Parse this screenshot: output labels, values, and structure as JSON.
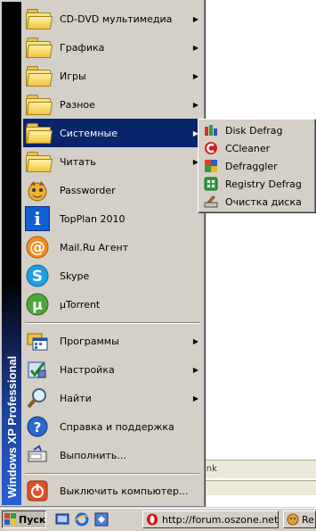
{
  "banner": {
    "text": "Windows XP  Professional"
  },
  "menu": {
    "items": [
      {
        "label": "CD-DVD мультимедиа",
        "icon": "folder-icon",
        "submenu": true
      },
      {
        "label": "Графика",
        "icon": "folder-icon",
        "submenu": true
      },
      {
        "label": "Игры",
        "icon": "folder-icon",
        "submenu": true
      },
      {
        "label": "Разное",
        "icon": "folder-icon",
        "submenu": true
      },
      {
        "label": "Системные",
        "icon": "folder-icon",
        "submenu": true,
        "selected": true
      },
      {
        "label": "Читать",
        "icon": "folder-icon",
        "submenu": true
      },
      {
        "label": "Passworder",
        "icon": "passworder-icon"
      },
      {
        "label": "TopPlan 2010",
        "icon": "topplan-icon"
      },
      {
        "label": "Mail.Ru Агент",
        "icon": "mailru-agent-icon"
      },
      {
        "label": "Skype",
        "icon": "skype-icon"
      },
      {
        "label": "µTorrent",
        "icon": "utorrent-icon"
      },
      {
        "label": "Программы",
        "icon": "programs-icon",
        "submenu": true
      },
      {
        "label": "Настройка",
        "icon": "settings-icon",
        "submenu": true
      },
      {
        "label": "Найти",
        "icon": "search-icon",
        "submenu": true
      },
      {
        "label": "Справка и поддержка",
        "icon": "help-icon"
      },
      {
        "label": "Выполнить...",
        "icon": "run-icon"
      },
      {
        "label": "Выключить компьютер...",
        "icon": "shutdown-icon"
      }
    ],
    "submenu_arrow": "▶"
  },
  "submenu": {
    "items": [
      {
        "label": "Disk Defrag",
        "icon": "disk-defrag-icon"
      },
      {
        "label": "CCleaner",
        "icon": "ccleaner-icon"
      },
      {
        "label": "Defraggler",
        "icon": "defraggler-icon"
      },
      {
        "label": "Registry Defrag",
        "icon": "registry-defrag-icon"
      },
      {
        "label": "Очистка диска",
        "icon": "disk-cleanup-icon"
      }
    ]
  },
  "background_window": {
    "partial_text": "ink"
  },
  "taskbar": {
    "start_label": "Пуск",
    "tasks": [
      {
        "label": "http://forum.oszone.net...",
        "icon": "opera-icon"
      },
      {
        "label": "Re",
        "icon": "app-icon"
      }
    ]
  },
  "colors": {
    "highlight": "#0a246a",
    "menu_bg": "#d4d0c8",
    "banner_bottom": "#2a5fd6"
  }
}
